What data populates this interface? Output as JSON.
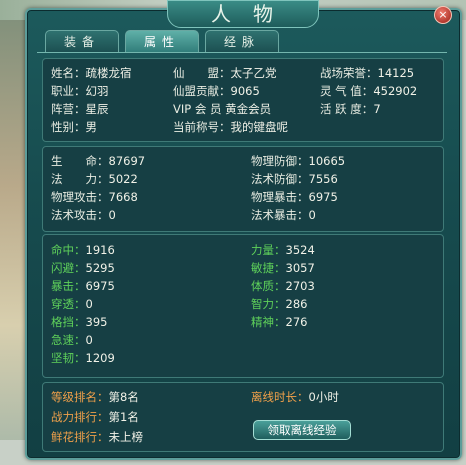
{
  "window": {
    "title": "人物",
    "close": "×"
  },
  "tabs": [
    {
      "label": "装备",
      "active": false
    },
    {
      "label": "属性",
      "active": true
    },
    {
      "label": "经脉",
      "active": false
    }
  ],
  "basic": {
    "name_label": "姓名：",
    "name": "疏楼龙宿",
    "class_label": "职业：",
    "class": "幻羽",
    "camp_label": "阵营：",
    "camp": "星辰",
    "gender_label": "性别：",
    "gender": "男",
    "alliance_label": "仙　　盟：",
    "alliance": "太子乙党",
    "contrib_label": "仙盟贡献：",
    "contrib": "9065",
    "vip_label": "VIP 会 员",
    "vip": "黄金会员",
    "title_label": "当前称号：",
    "title": "我的键盘呢",
    "honor_label": "战场荣誉：",
    "honor": "14125",
    "spirit_label": "灵 气 值：",
    "spirit": "452902",
    "active_label": "活 跃 度：",
    "active": "7"
  },
  "stats": {
    "hp_label": "生　　命：",
    "hp": "87697",
    "mp_label": "法　　力：",
    "mp": "5022",
    "patk_label": "物理攻击：",
    "patk": "7668",
    "matk_label": "法术攻击：",
    "matk": "0",
    "pdef_label": "物理防御：",
    "pdef": "10665",
    "mdef_label": "法术防御：",
    "mdef": "7556",
    "pcrit_label": "物理暴击：",
    "pcrit": "6975",
    "mcrit_label": "法术暴击：",
    "mcrit": "0"
  },
  "attrs": [
    {
      "label": "命中：",
      "value": "1916"
    },
    {
      "label": "闪避：",
      "value": "5295"
    },
    {
      "label": "暴击：",
      "value": "6975"
    },
    {
      "label": "穿透：",
      "value": "0"
    },
    {
      "label": "格挡：",
      "value": "395"
    },
    {
      "label": "急速：",
      "value": "0"
    },
    {
      "label": "坚韧：",
      "value": "1209"
    }
  ],
  "attrs_right": [
    {
      "label": "力量：",
      "value": "3524"
    },
    {
      "label": "敏捷：",
      "value": "3057"
    },
    {
      "label": "体质：",
      "value": "2703"
    },
    {
      "label": "智力：",
      "value": "286"
    },
    {
      "label": "精神：",
      "value": "276"
    }
  ],
  "ranking": {
    "level_label": "等级排名：",
    "level": "第8名",
    "power_label": "战力排行：",
    "power": "第1名",
    "flower_label": "鲜花排行：",
    "flower": "未上榜",
    "offline_label": "离线时长：",
    "offline": "0小时",
    "claim_button": "领取离线经验"
  },
  "colors": {
    "green": "#5fd15a",
    "orange": "#f0a04a",
    "panel": "#163f44"
  }
}
